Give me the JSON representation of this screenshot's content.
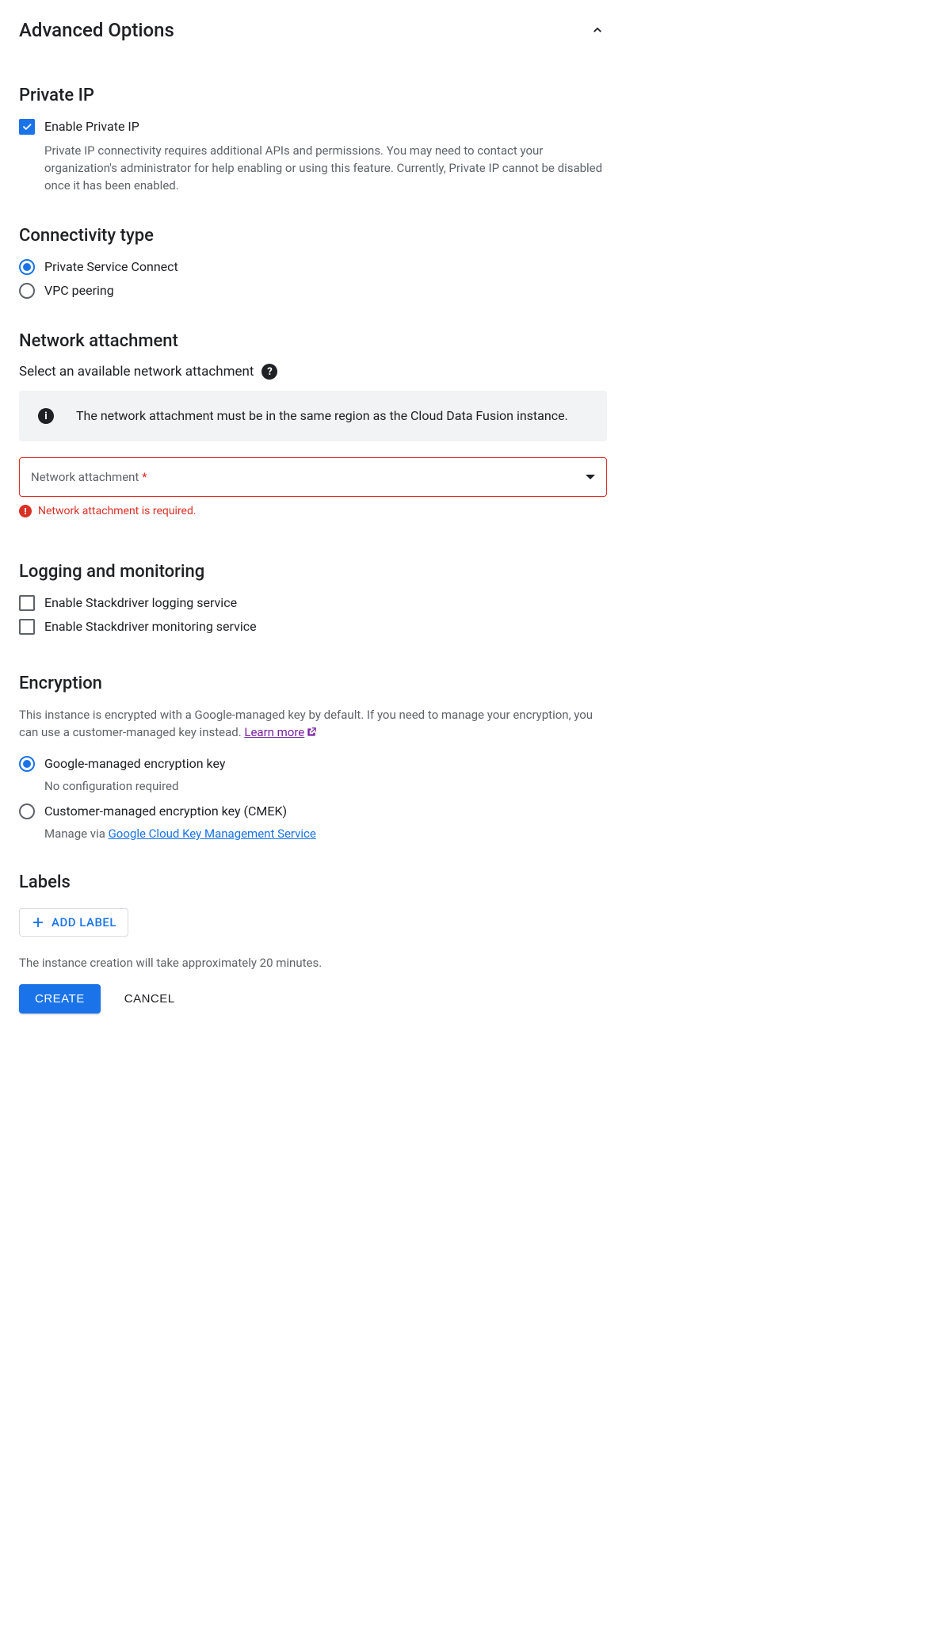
{
  "header": {
    "title": "Advanced Options"
  },
  "private_ip": {
    "heading": "Private IP",
    "enable_label": "Enable Private IP",
    "enable_checked": true,
    "desc": "Private IP connectivity requires additional APIs and permissions. You may need to contact your organization's administrator for help enabling or using this feature. Currently, Private IP cannot be disabled once it has been enabled."
  },
  "connectivity": {
    "heading": "Connectivity type",
    "options": [
      {
        "label": "Private Service Connect",
        "selected": true
      },
      {
        "label": "VPC peering",
        "selected": false
      }
    ]
  },
  "network_attachment": {
    "heading": "Network attachment",
    "hint": "Select an available network attachment",
    "info": "The network attachment must be in the same region as the Cloud Data Fusion instance.",
    "field_label": "Network attachment",
    "required_mark": "*",
    "error": "Network attachment is required."
  },
  "logging": {
    "heading": "Logging and monitoring",
    "options": [
      {
        "label": "Enable Stackdriver logging service",
        "checked": false
      },
      {
        "label": "Enable Stackdriver monitoring service",
        "checked": false
      }
    ]
  },
  "encryption": {
    "heading": "Encryption",
    "desc_a": "This instance is encrypted with a Google-managed key by default. If you need to manage your encryption, you can use a customer-managed key instead. ",
    "learn_more": "Learn more",
    "options": [
      {
        "label": "Google-managed encryption key",
        "sub": "No configuration required",
        "selected": true
      },
      {
        "label": "Customer-managed encryption key (CMEK)",
        "sub_prefix": "Manage via ",
        "sub_link": "Google Cloud Key Management Service",
        "selected": false
      }
    ]
  },
  "labels": {
    "heading": "Labels",
    "add_button": "ADD LABEL"
  },
  "footer": {
    "note": "The instance creation will take approximately 20 minutes.",
    "create": "CREATE",
    "cancel": "CANCEL"
  }
}
